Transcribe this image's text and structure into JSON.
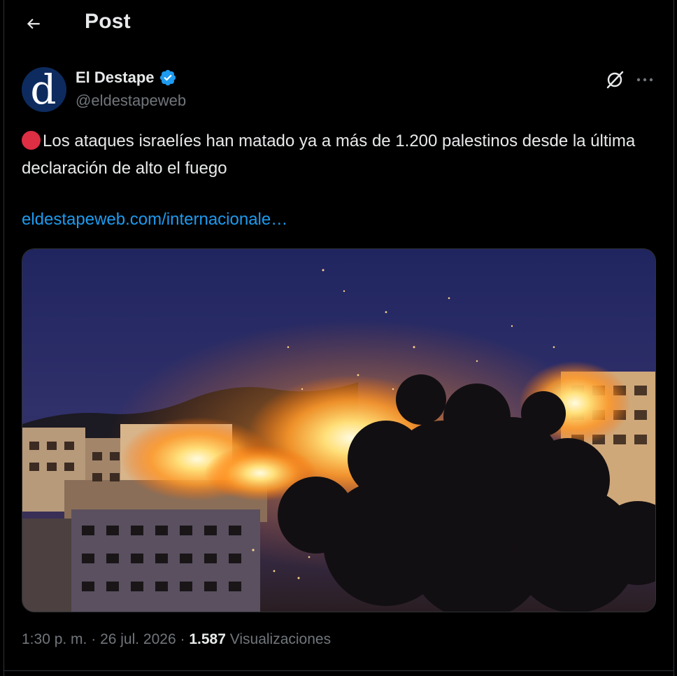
{
  "header": {
    "title": "Post",
    "back_icon": "arrow-left-icon"
  },
  "author": {
    "avatar_letter": "d",
    "name": "El Destape",
    "handle": "@eldestapeweb",
    "verified_icon": "verified-badge-icon",
    "colors": {
      "verified": "#1d9bf0",
      "avatar_bg": "#0d2b5e"
    }
  },
  "actions": {
    "grok_icon": "grok-icon",
    "more_icon": "more-horizontal-icon"
  },
  "post": {
    "emoji": "red-circle-icon",
    "text": "Los ataques israelíes han matado ya a más de 1.200 palestinos desde la última declaración de alto el fuego",
    "link": "eldestapeweb.com/internacionale…",
    "media_description": "photo"
  },
  "meta": {
    "time": "1:30 p. m.",
    "sep1": " · ",
    "date": "26 jul. 2026",
    "sep2": " · ",
    "views": "1.587",
    "views_label": " Visualizaciones"
  },
  "colors": {
    "background": "#000000",
    "text": "#e7e9ea",
    "muted": "#71767b",
    "link": "#1d9bf0",
    "red_dot": "#dd2e44"
  }
}
